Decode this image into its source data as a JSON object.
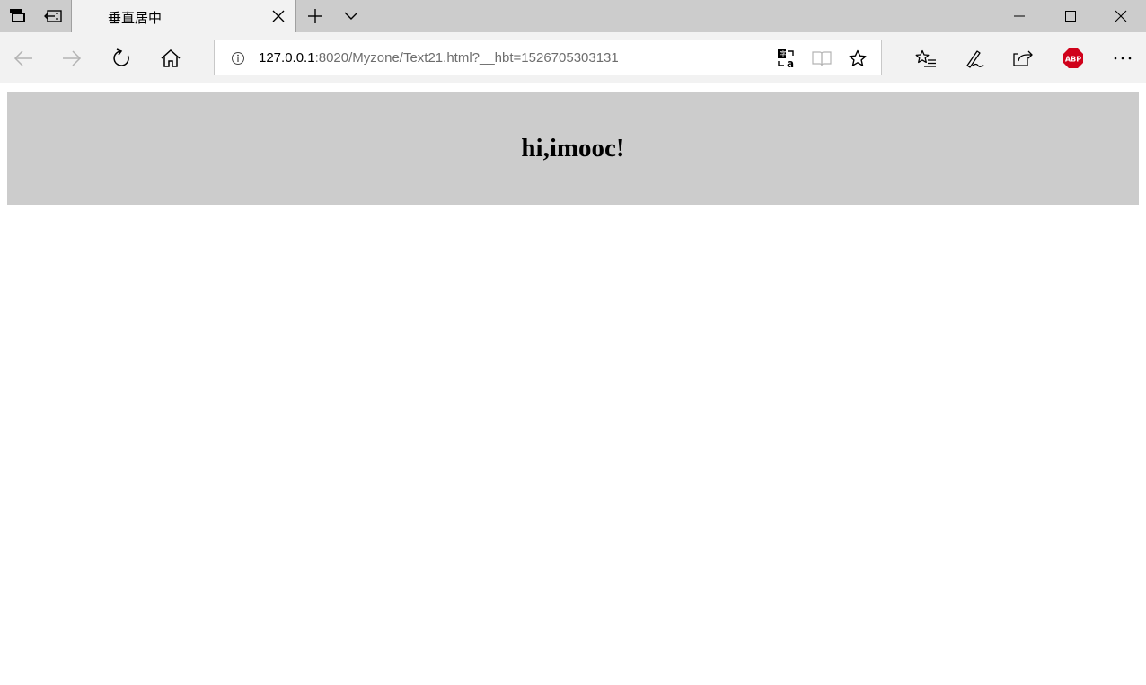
{
  "browser": {
    "tab": {
      "title": "垂直居中"
    },
    "address_bar": {
      "url_host": "127.0.0.1",
      "url_rest": ":8020/Myzone/Text21.html?__hbt=1526705303131"
    },
    "extension": {
      "label": "ABP"
    },
    "colors": {
      "tabbar": "#cccccc",
      "active_tab": "#f2f2f2",
      "abp_red": "#d0021b"
    }
  },
  "page": {
    "heading": "hi,imooc!",
    "box_background": "#cccccc"
  }
}
